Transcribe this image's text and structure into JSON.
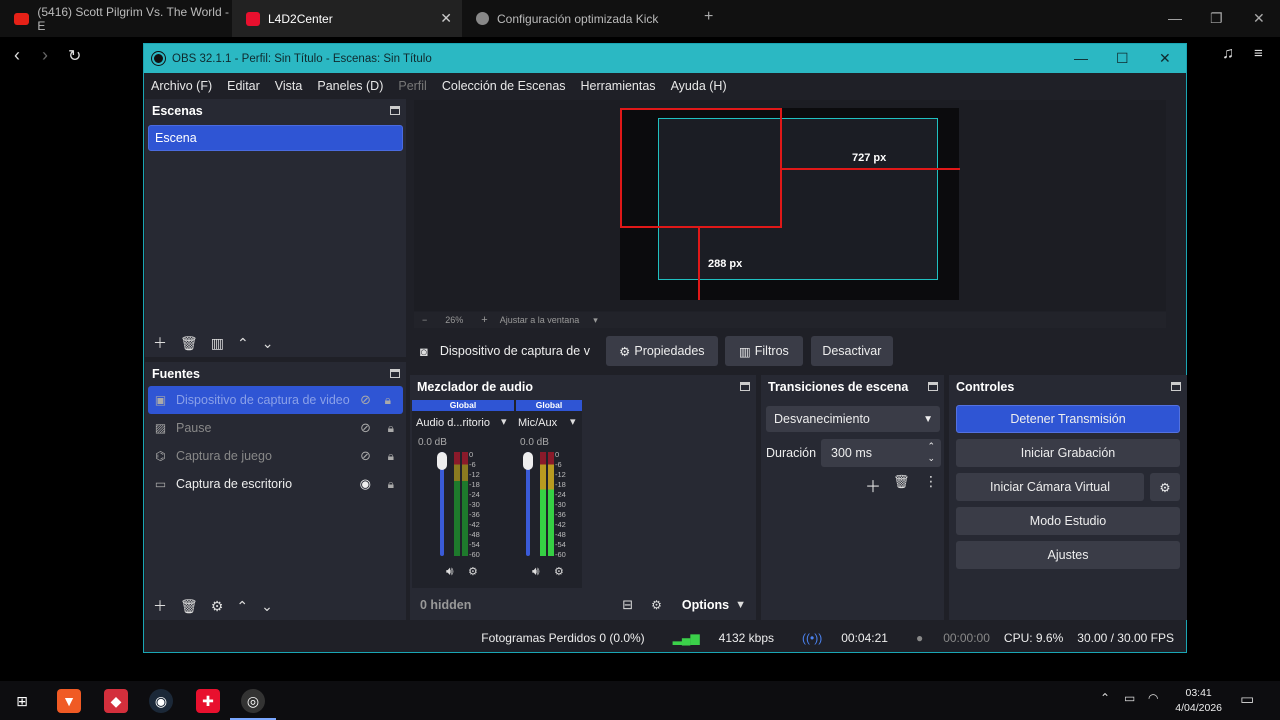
{
  "browser": {
    "tabs": [
      {
        "label": "(5416) Scott Pilgrim Vs. The World - E",
        "color": "#e62117"
      },
      {
        "label": "L4D2Center",
        "color": "#e8102e"
      },
      {
        "label": "Configuración optimizada Kick",
        "color": "#888888"
      }
    ]
  },
  "obs": {
    "title": "OBS 32.1.1 - Perfil: Sin Título - Escenas: Sin Título",
    "menu": [
      "Archivo (F)",
      "Editar",
      "Vista",
      "Paneles (D)",
      "Perfil",
      "Colección de Escenas",
      "Herramientas",
      "Ayuda (H)"
    ],
    "scenes": {
      "title": "Escenas",
      "items": [
        "Escena"
      ]
    },
    "sources": {
      "title": "Fuentes",
      "items": [
        {
          "label": "Dispositivo de captura de video",
          "icon": "camera-icon"
        },
        {
          "label": "Pause",
          "icon": "image-icon"
        },
        {
          "label": "Captura de juego",
          "icon": "gamepad-icon"
        },
        {
          "label": "Captura de escritorio",
          "icon": "monitor-icon"
        }
      ]
    },
    "preview": {
      "zoom": "26%",
      "fit": "Ajustar a la ventana",
      "label_a": "727 px",
      "label_b": "288 px"
    },
    "source_bar": {
      "name": "Dispositivo de captura de v",
      "properties": "Propiedades",
      "filters": "Filtros",
      "deactivate": "Desactivar"
    },
    "mixer": {
      "title": "Mezclador de audio",
      "channels": [
        {
          "badge": "Global",
          "name": "Audio d...ritorio",
          "db": "0.0 dB"
        },
        {
          "badge": "Global",
          "name": "Mic/Aux",
          "db": "0.0 dB"
        }
      ],
      "ticks": [
        "0",
        "-6",
        "-12",
        "-18",
        "-24",
        "-30",
        "-36",
        "-42",
        "-48",
        "-54",
        "-60"
      ],
      "hidden": "0 hidden",
      "options": "Options"
    },
    "transitions": {
      "title": "Transiciones de escena",
      "selected": "Desvanecimiento",
      "duration_label": "Duración",
      "duration": "300 ms"
    },
    "controls": {
      "title": "Controles",
      "stop_stream": "Detener Transmisión",
      "start_rec": "Iniciar Grabación",
      "virtual_cam": "Iniciar Cámara Virtual",
      "studio": "Modo Estudio",
      "settings": "Ajustes"
    },
    "status": {
      "dropped": "Fotogramas Perdidos 0 (0.0%)",
      "bitrate": "4132 kbps",
      "stream_time": "00:04:21",
      "rec_time": "00:00:00",
      "cpu": "CPU: 9.6%",
      "fps": "30.00 / 30.00 FPS"
    }
  },
  "taskbar": {
    "time": "03:41",
    "date": "4/04/2026"
  }
}
